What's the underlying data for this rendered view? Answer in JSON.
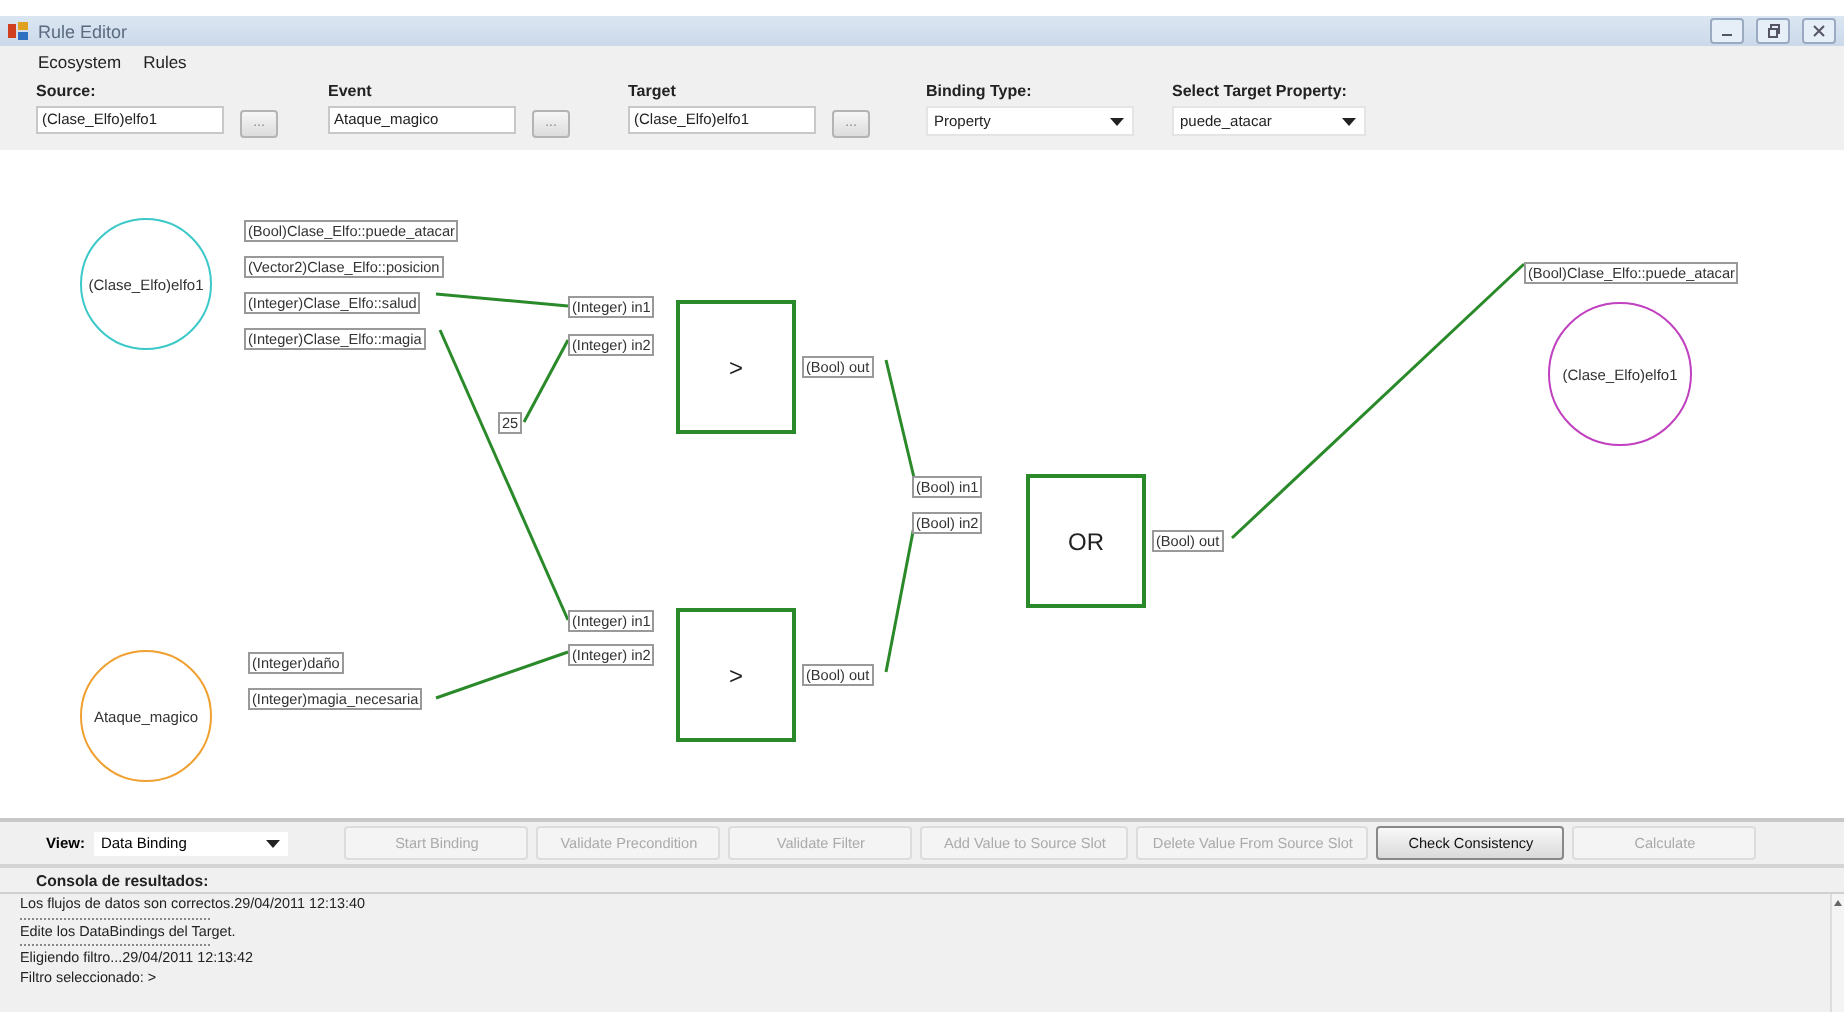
{
  "window": {
    "title": "Rule Editor"
  },
  "menu": [
    {
      "label": "Ecosystem"
    },
    {
      "label": "Rules"
    }
  ],
  "header_fields": [
    {
      "kind": "text",
      "label": "Source:",
      "value": "(Clase_Elfo)elfo1",
      "browse": "..."
    },
    {
      "kind": "text",
      "label": "Event",
      "value": "Ataque_magico",
      "browse": "..."
    },
    {
      "kind": "text",
      "label": "Target",
      "value": "(Clase_Elfo)elfo1",
      "browse": "..."
    },
    {
      "kind": "combo",
      "label": "Binding Type:",
      "value": "Property"
    },
    {
      "kind": "combo",
      "label": "Select Target Property:",
      "value": "puede_atacar"
    }
  ],
  "diagram": {
    "nodes": [
      {
        "kind": "entity",
        "label": "(Clase_Elfo)elfo1",
        "color": "#3cc8c8",
        "ports": [
          "(Bool)Clase_Elfo::puede_atacar",
          "(Vector2)Clase_Elfo::posicion",
          "(Integer)Clase_Elfo::salud",
          "(Integer)Clase_Elfo::magia"
        ]
      },
      {
        "kind": "entity",
        "label": "Ataque_magico",
        "color": "#f0a030",
        "ports": [
          "(Integer)daño",
          "(Integer)magia_necesaria"
        ]
      },
      {
        "kind": "entity",
        "label": "(Clase_Elfo)elfo1",
        "color": "#c040c0",
        "ports": [
          "(Bool)Clase_Elfo::puede_atacar"
        ]
      },
      {
        "kind": "operator",
        "symbol": ">",
        "inputs": [
          "(Integer) in1",
          "(Integer) in2"
        ],
        "output": "(Bool) out"
      },
      {
        "kind": "operator",
        "symbol": ">",
        "inputs": [
          "(Integer) in1",
          "(Integer) in2"
        ],
        "output": "(Bool) out"
      },
      {
        "kind": "operator",
        "symbol": "OR",
        "inputs": [
          "(Bool) in1",
          "(Bool) in2"
        ],
        "output": "(Bool) out"
      },
      {
        "kind": "constant",
        "value": "25"
      }
    ]
  },
  "toolbar": {
    "view_label": "View:",
    "view_value": "Data Binding",
    "buttons": [
      {
        "label": "Start Binding",
        "disabled": true
      },
      {
        "label": "Validate Precondition",
        "disabled": true
      },
      {
        "label": "Validate Filter",
        "disabled": true
      },
      {
        "label": "Add Value to Source Slot",
        "disabled": true
      },
      {
        "label": "Delete Value From Source Slot",
        "disabled": true
      },
      {
        "label": "Check Consistency",
        "disabled": false
      },
      {
        "label": "Calculate",
        "disabled": true
      }
    ]
  },
  "console": {
    "title": "Consola de resultados:",
    "lines": [
      {
        "kind": "text",
        "text": "Los flujos de datos son correctos.29/04/2011 12:13:40"
      },
      {
        "kind": "separator"
      },
      {
        "kind": "text",
        "text": "Edite los DataBindings del Target."
      },
      {
        "kind": "separator"
      },
      {
        "kind": "text",
        "text": "Eligiendo filtro...29/04/2011 12:13:42"
      },
      {
        "kind": "text",
        "text": "Filtro seleccionado: >"
      }
    ]
  }
}
